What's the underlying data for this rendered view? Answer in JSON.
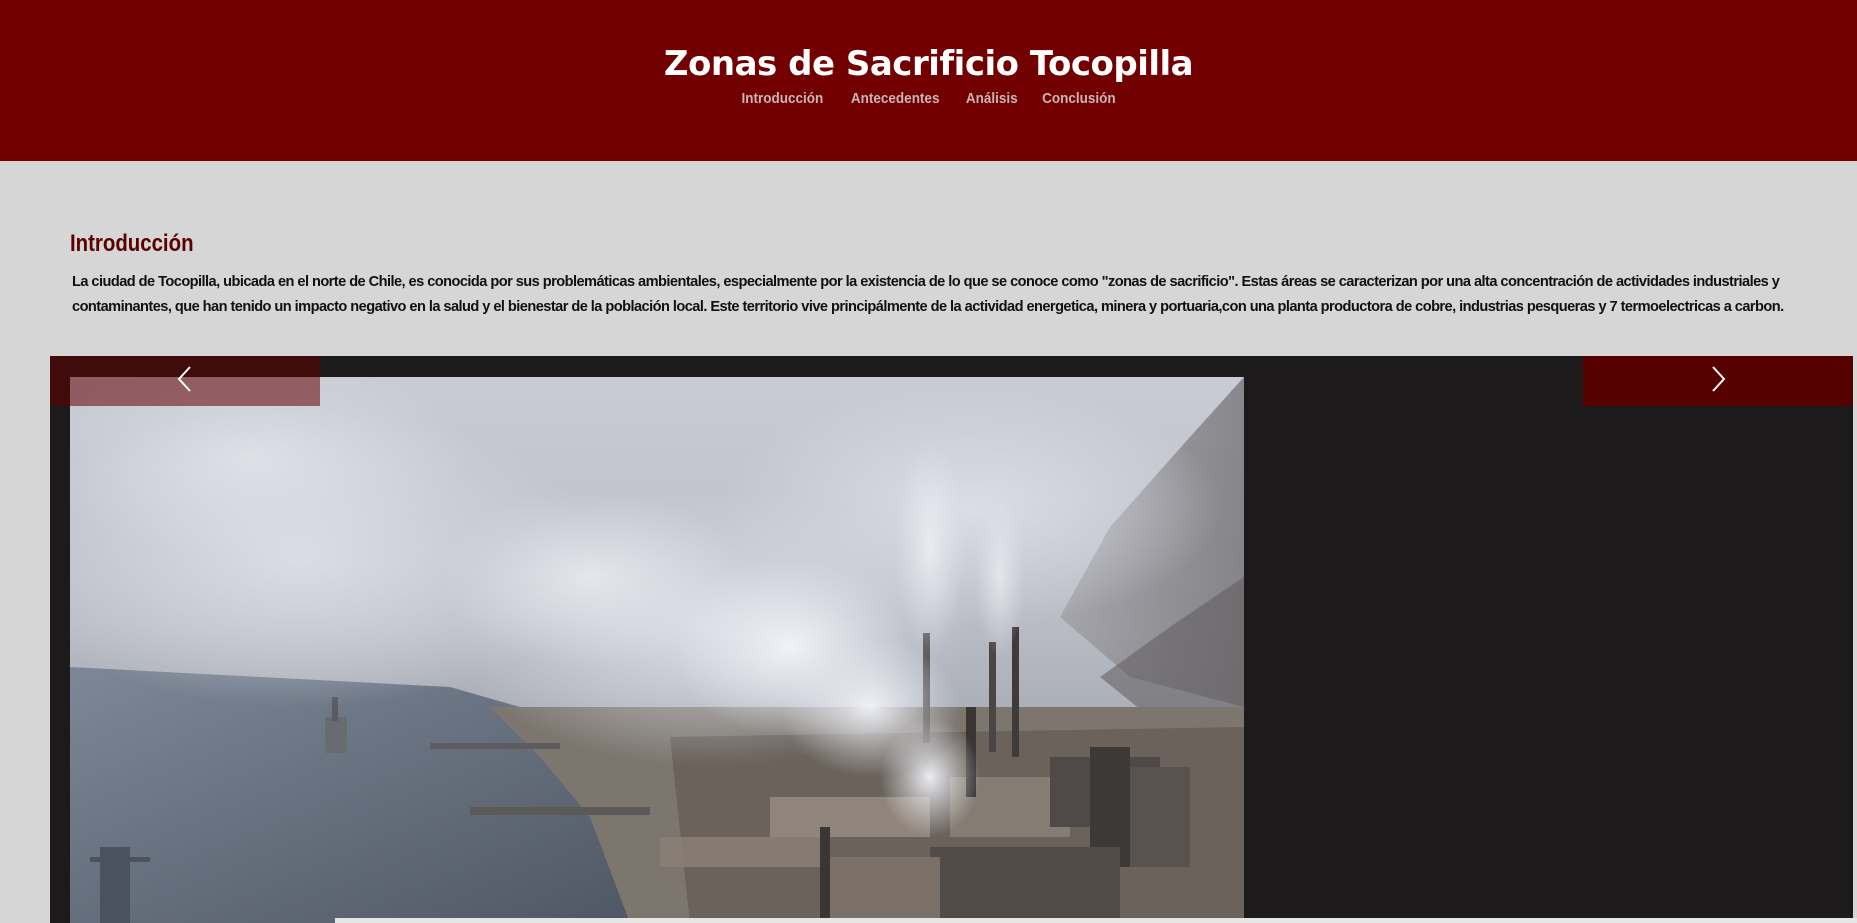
{
  "header": {
    "title": "Zonas de Sacrificio Tocopilla",
    "nav": [
      {
        "label": "Introducción"
      },
      {
        "label": "Antecedentes"
      },
      {
        "label": "Análisis"
      },
      {
        "label": "Conclusión"
      }
    ]
  },
  "intro": {
    "heading": "Introducción",
    "text": "La ciudad de Tocopilla, ubicada en el norte de Chile, es conocida por sus problemáticas ambientales, especialmente por la existencia de lo que se conoce como \"zonas de sacrificio\". Estas áreas se caracterizan por una alta concentración de actividades industriales y contaminantes, que han tenido un impacto negativo en la salud y el bienestar de la población local. Este territorio vive principálmente de la actividad energetica, minera y portuaria,con una planta productora de cobre, industrias pesqueras y 7 termoelectricas a carbon."
  },
  "carousel": {
    "prev_icon": "chevron-left-icon",
    "next_icon": "chevron-right-icon"
  },
  "colors": {
    "header_bg": "#720000",
    "page_bg": "#d6d6d6",
    "heading": "#5b0000",
    "carousel_bg": "#1c1a1a",
    "nav_link": "#c9b5b5"
  }
}
